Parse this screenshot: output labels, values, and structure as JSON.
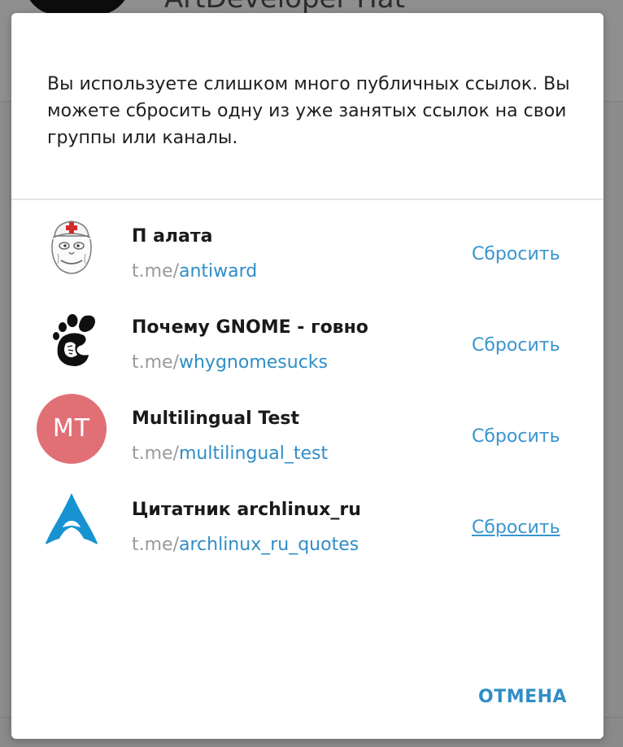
{
  "background": {
    "title": "ArtDeveloper Hat"
  },
  "dialog": {
    "message": "Вы используете слишком много публичных ссылок. Вы можете сбросить одну из уже занятых ссылок на свои группы или каналы.",
    "link_prefix": "t.me/",
    "channels": [
      {
        "name": "П алата",
        "username": "antiward",
        "avatar": "nurse-meme-icon",
        "reset_label": "Сбросить"
      },
      {
        "name": "Почему GNOME - говно",
        "username": "whygnomesucks",
        "avatar": "gnome-foot-icon",
        "reset_label": "Сбросить"
      },
      {
        "name": "Multilingual Test",
        "username": "multilingual_test",
        "avatar_initials": "MT",
        "avatar_color": "#e17076",
        "reset_label": "Сбросить"
      },
      {
        "name": "Цитатник archlinux_ru",
        "username": "archlinux_ru_quotes",
        "avatar": "arch-linux-icon",
        "reset_label": "Сбросить"
      }
    ],
    "cancel_label": "ОТМЕНА"
  },
  "colors": {
    "accent": "#2f8ec6",
    "link_prefix": "#9a9a9a",
    "avatar_mt": "#e17076",
    "arch_blue": "#1793d1"
  }
}
